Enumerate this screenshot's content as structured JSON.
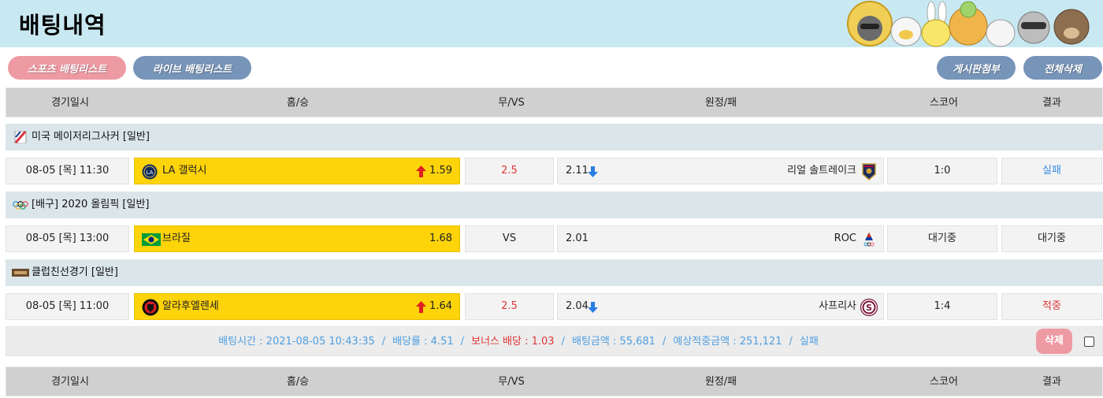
{
  "header": {
    "title": "배팅내역"
  },
  "tabs": {
    "sports": "스포츠 배팅리스트",
    "live": "라이브 배팅리스트",
    "attach": "게시판첨부",
    "delete_all": "전체삭제"
  },
  "columns": {
    "date": "경기일시",
    "home": "홈/승",
    "draw": "무/VS",
    "away": "원정/패",
    "score": "스코어",
    "result": "결과"
  },
  "bets": [
    {
      "league": "미국 메이저리그사커 [일반]",
      "league_icon": "mls-icon",
      "date": "08-05 [목] 11:30",
      "home_team": "LA 갤럭시",
      "home_logo": "la-galaxy-logo-icon",
      "home_odds": "1.59",
      "home_trend": "up-arrow-icon",
      "draw": "2.5",
      "away_odds": "2.11",
      "away_trend": "down-arrow-icon",
      "away_team": "리얼 솔트레이크",
      "away_logo": "real-salt-lake-logo-icon",
      "score": "1:0",
      "result": "실패",
      "result_color": "#3a8de0"
    },
    {
      "league": "[배구] 2020 올림픽 [일반]",
      "league_icon": "olympic-rings-icon",
      "date": "08-05 [목] 13:00",
      "home_team": "브라질",
      "home_logo": "brazil-flag-icon",
      "home_odds": "1.68",
      "draw": "VS",
      "away_odds": "2.01",
      "away_team": "ROC",
      "away_logo": "roc-logo-icon",
      "score": "대기중",
      "result": "대기중",
      "result_color": "#222222"
    },
    {
      "league": "클럽친선경기 [일반]",
      "league_icon": "club-friendly-icon",
      "date": "08-05 [목] 11:00",
      "home_team": "알라후엘렌세",
      "home_logo": "alajuelense-logo-icon",
      "home_odds": "1.64",
      "home_trend": "up-arrow-icon",
      "draw": "2.5",
      "away_odds": "2.04",
      "away_trend": "down-arrow-icon",
      "away_team": "사프리사",
      "away_logo": "saprissa-logo-icon",
      "score": "1:4",
      "result": "적중",
      "result_color": "#e03535"
    }
  ],
  "summary": {
    "bet_time": "배팅시간 : 2021-08-05 10:43:35",
    "odds": "배당률 : 4.51",
    "bonus": "보너스 배당 : 1.03",
    "amount": "배팅금액 : 55,681",
    "expected": "예상적중금액 : 251,121",
    "status": "실패",
    "separator": "/",
    "delete_label": "삭제"
  },
  "colors": {
    "header_bg": "#c9e9f2",
    "home_highlight": "#fdd30a",
    "pink": "#ee9aa3",
    "blue_button": "#7794b9",
    "red": "#e03535",
    "blue": "#3a8de0"
  }
}
